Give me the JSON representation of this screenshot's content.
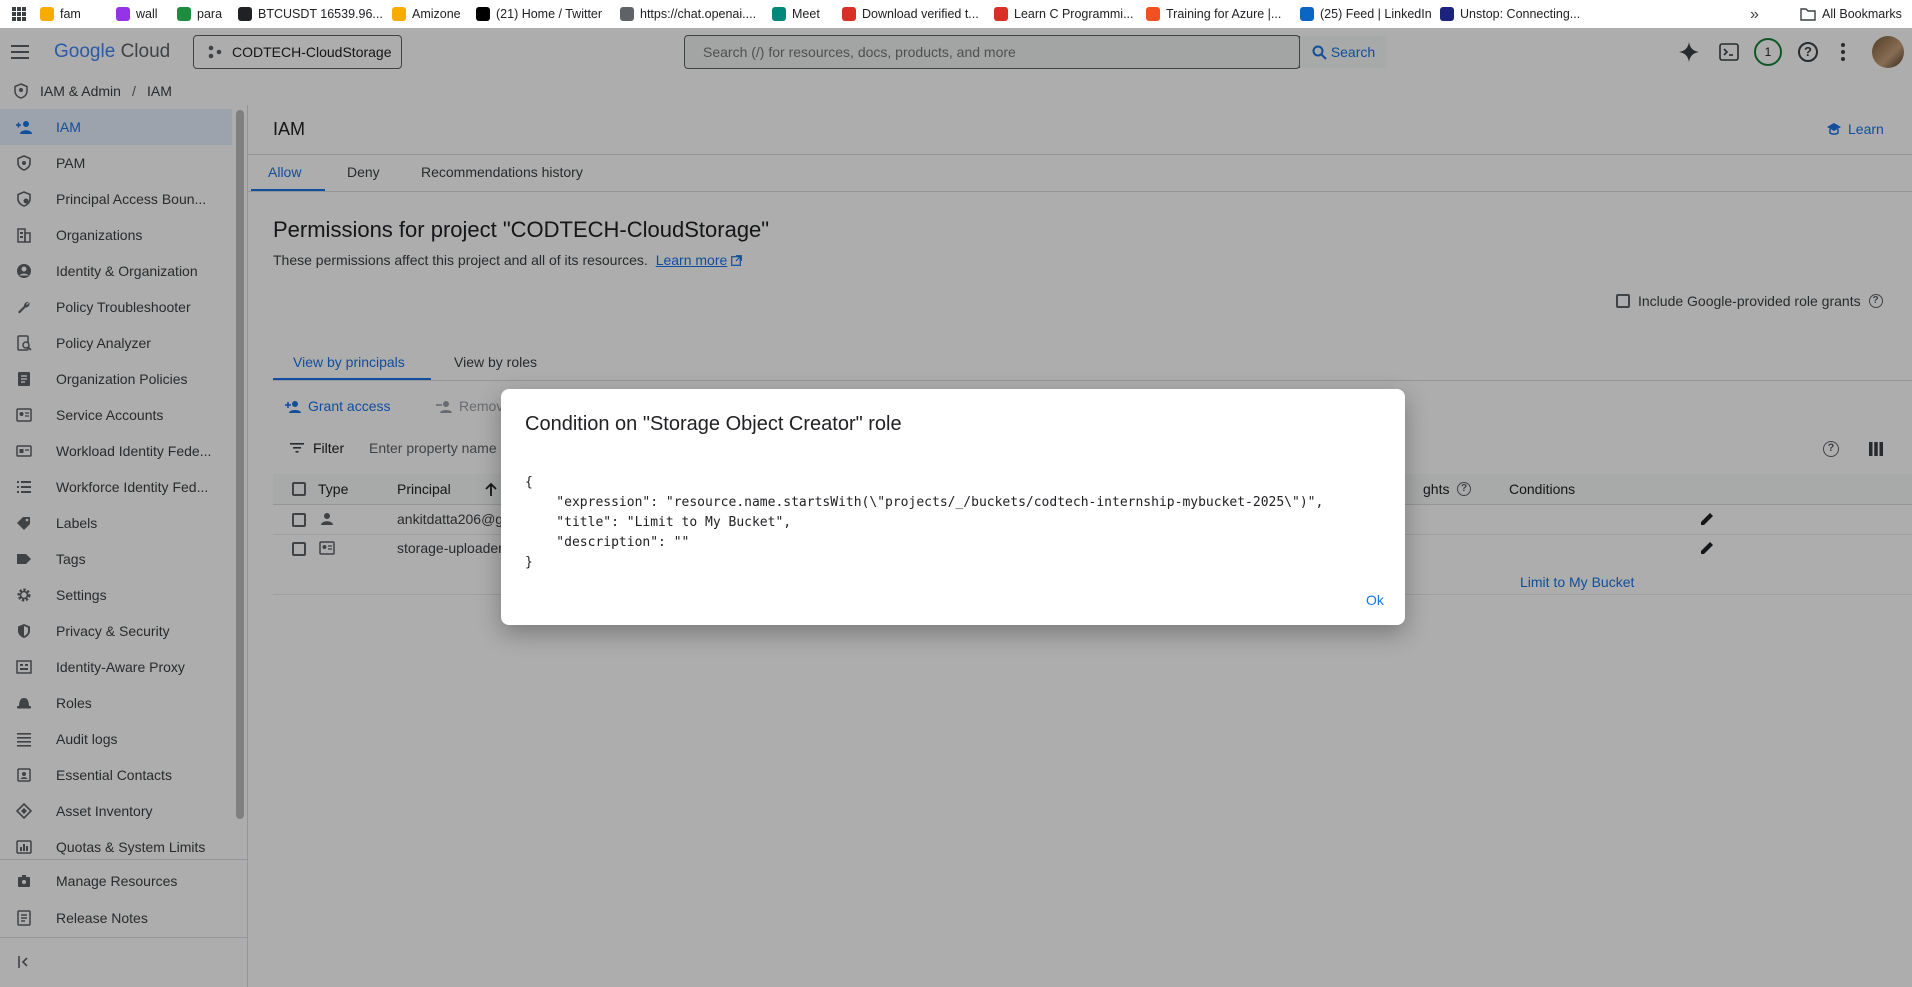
{
  "bookmarks": {
    "items": [
      {
        "label": "fam",
        "color": "#f9ab00"
      },
      {
        "label": "wall",
        "color": "#9334e6"
      },
      {
        "label": "para",
        "color": "#1e8e3e"
      },
      {
        "label": "BTCUSDT 16539.96...",
        "color": "#202124"
      },
      {
        "label": "Amizone",
        "color": "#f9ab00"
      },
      {
        "label": "(21) Home / Twitter",
        "color": "#000000"
      },
      {
        "label": "https://chat.openai....",
        "color": "#5f6368"
      },
      {
        "label": "Meet",
        "color": "#00897b"
      },
      {
        "label": "Download verified t...",
        "color": "#d93025"
      },
      {
        "label": "Learn C Programmi...",
        "color": "#d93025"
      },
      {
        "label": "Training for Azure |...",
        "color": "#f25022"
      },
      {
        "label": "(25) Feed | LinkedIn",
        "color": "#0a66c2"
      },
      {
        "label": "Unstop: Connecting...",
        "color": "#1a237e"
      }
    ],
    "all_bookmarks": "All Bookmarks"
  },
  "header": {
    "logo_google": "Google",
    "logo_cloud": "Cloud",
    "project": "CODTECH-CloudStorage",
    "search_placeholder": "Search (/) for resources, docs, products, and more",
    "search_button": "Search",
    "notification_count": "1"
  },
  "breadcrumb": {
    "section": "IAM & Admin",
    "separator": "/",
    "page": "IAM"
  },
  "sidebar": {
    "items": [
      {
        "label": "IAM",
        "icon": "person-add-icon"
      },
      {
        "label": "PAM",
        "icon": "shield-icon"
      },
      {
        "label": "Principal Access Boun...",
        "icon": "policy-icon"
      },
      {
        "label": "Organizations",
        "icon": "building-icon"
      },
      {
        "label": "Identity & Organization",
        "icon": "account-circle-icon"
      },
      {
        "label": "Policy Troubleshooter",
        "icon": "wrench-icon"
      },
      {
        "label": "Policy Analyzer",
        "icon": "analyzer-icon"
      },
      {
        "label": "Organization Policies",
        "icon": "document-icon"
      },
      {
        "label": "Service Accounts",
        "icon": "service-account-icon"
      },
      {
        "label": "Workload Identity Fede...",
        "icon": "id-card-icon"
      },
      {
        "label": "Workforce Identity Fed...",
        "icon": "list-icon"
      },
      {
        "label": "Labels",
        "icon": "label-icon"
      },
      {
        "label": "Tags",
        "icon": "tag-icon"
      },
      {
        "label": "Settings",
        "icon": "gear-icon"
      },
      {
        "label": "Privacy & Security",
        "icon": "security-icon"
      },
      {
        "label": "Identity-Aware Proxy",
        "icon": "proxy-icon"
      },
      {
        "label": "Roles",
        "icon": "hat-icon"
      },
      {
        "label": "Audit logs",
        "icon": "list-lines-icon"
      },
      {
        "label": "Essential Contacts",
        "icon": "contacts-icon"
      },
      {
        "label": "Asset Inventory",
        "icon": "diamond-icon"
      },
      {
        "label": "Quotas & System Limits",
        "icon": "quota-icon"
      }
    ],
    "manage_resources": "Manage Resources",
    "release_notes": "Release Notes"
  },
  "main": {
    "title": "IAM",
    "learn": "Learn",
    "tabs": [
      "Allow",
      "Deny",
      "Recommendations history"
    ],
    "permissions_title": "Permissions for project \"CODTECH-CloudStorage\"",
    "permissions_desc": "These permissions affect this project and all of its resources.",
    "learn_more": "Learn more",
    "include_grants": "Include Google-provided role grants",
    "view_tabs": [
      "View by principals",
      "View by roles"
    ],
    "grant_access": "Grant access",
    "remove_access": "Remov",
    "filter_label": "Filter",
    "filter_placeholder": "Enter property name or",
    "table": {
      "headers": {
        "type": "Type",
        "principal": "Principal",
        "insights": "ghts",
        "conditions": "Conditions"
      },
      "rows": [
        {
          "principal": "ankitdatta206@g",
          "condition": ""
        },
        {
          "principal": "storage-uploader",
          "condition": "Limit to My Bucket"
        }
      ]
    }
  },
  "dialog": {
    "title": "Condition on \"Storage Object Creator\" role",
    "code_lines": [
      "{",
      "    \"expression\": \"resource.name.startsWith(\\\"projects/_/buckets/codtech-internship-mybucket-2025\\\")\",",
      "    \"title\": \"Limit to My Bucket\",",
      "    \"description\": \"\"",
      "}"
    ],
    "ok": "Ok"
  }
}
